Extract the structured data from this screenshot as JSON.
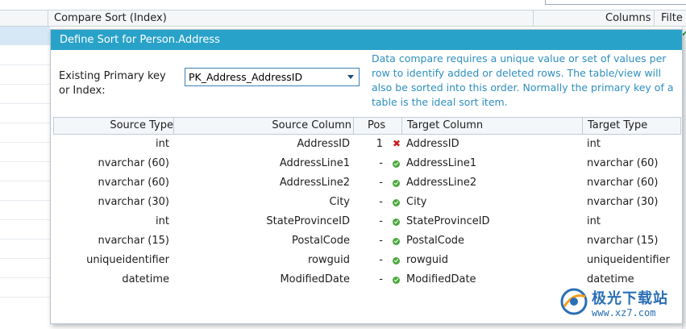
{
  "background": {
    "header": {
      "compare_sort": "Compare Sort (Index)",
      "columns": "Columns",
      "filter": "Filte"
    }
  },
  "panel": {
    "title": "Define Sort for Person.Address",
    "key_label": "Existing Primary key or Index:",
    "key_selected": "PK_Address_AddressID",
    "info_text": "Data compare requires a unique value or set of values per row to identify added or deleted rows. The table/view will also be sorted into this order. Normally the primary key of a table is the ideal sort item."
  },
  "table": {
    "headers": {
      "source_type": "Source Type",
      "source_column": "Source Column",
      "pos": "Pos",
      "target_column": "Target Column",
      "target_type": "Target Type"
    },
    "rows": [
      {
        "source_type": "int",
        "source_column": "AddressID",
        "pos": "1",
        "status": "error",
        "target_column": "AddressID",
        "target_type": "int"
      },
      {
        "source_type": "nvarchar (60)",
        "source_column": "AddressLine1",
        "pos": "-",
        "status": "ok",
        "target_column": "AddressLine1",
        "target_type": "nvarchar (60)"
      },
      {
        "source_type": "nvarchar (60)",
        "source_column": "AddressLine2",
        "pos": "-",
        "status": "ok",
        "target_column": "AddressLine2",
        "target_type": "nvarchar (60)"
      },
      {
        "source_type": "nvarchar (30)",
        "source_column": "City",
        "pos": "-",
        "status": "ok",
        "target_column": "City",
        "target_type": "nvarchar (30)"
      },
      {
        "source_type": "int",
        "source_column": "StateProvinceID",
        "pos": "-",
        "status": "ok",
        "target_column": "StateProvinceID",
        "target_type": "int"
      },
      {
        "source_type": "nvarchar (15)",
        "source_column": "PostalCode",
        "pos": "-",
        "status": "ok",
        "target_column": "PostalCode",
        "target_type": "nvarchar (15)"
      },
      {
        "source_type": "uniqueidentifier",
        "source_column": "rowguid",
        "pos": "-",
        "status": "ok",
        "target_column": "rowguid",
        "target_type": "uniqueidentifier"
      },
      {
        "source_type": "datetime",
        "source_column": "ModifiedDate",
        "pos": "-",
        "status": "ok",
        "target_column": "ModifiedDate",
        "target_type": "datetime"
      }
    ]
  },
  "watermark": {
    "text": "极光下载站",
    "url": "www.xz7.com"
  },
  "colors": {
    "title_bar": "#29a2c9",
    "info_text": "#2e8fbf",
    "ok": "#4aa83c",
    "error": "#cc1f1f"
  }
}
